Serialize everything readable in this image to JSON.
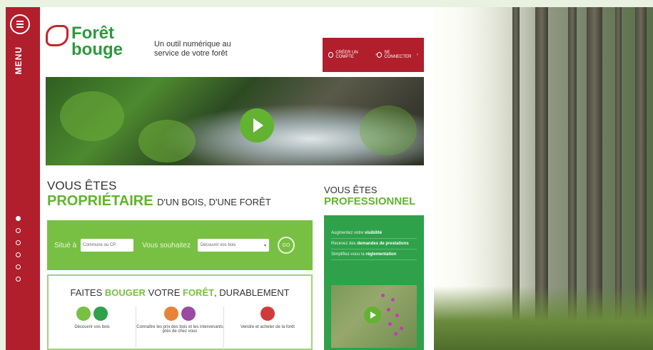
{
  "sidebar": {
    "menu_label": "MENU",
    "dots": 6,
    "active_dot": 0
  },
  "header": {
    "logo_text_top": "Forêt",
    "logo_text_bottom": "bouge",
    "tagline": "Un outil numérique au service de votre forêt",
    "create_account": "CRÉER UN COMPTE",
    "login": "SE CONNECTER"
  },
  "owner": {
    "line1": "VOUS ÊTES",
    "highlight": "PROPRIÉTAIRE",
    "rest": "D'UN BOIS, D'UNE FORÊT",
    "search": {
      "situe_label": "Situé à",
      "commune_placeholder": "Commune ou CP",
      "souhaitez_label": "Vous souhaitez",
      "select_value": "Découvrir vos bois",
      "go_label": "GO"
    },
    "cards_title_pre": "FAITES",
    "cards_title_highlight1": "BOUGER",
    "cards_title_mid": "VOTRE",
    "cards_title_highlight2": "FORÊT",
    "cards_title_post": ", DURABLEMENT",
    "cards": [
      {
        "text": "Découvrir vos bois"
      },
      {
        "text": "Connaître les prix des bois et les intervenants près de chez vous"
      },
      {
        "text": "Vendre et acheter de la forêt"
      }
    ]
  },
  "pro": {
    "line1": "VOUS ÊTES",
    "highlight": "PROFESSIONNEL",
    "items": [
      {
        "pre": "Augmentez votre",
        "bold": "visibilité"
      },
      {
        "pre": "Recevez des",
        "bold": "demandes de prestations"
      },
      {
        "pre": "Simplifiez-vous la",
        "bold": "réglementation"
      }
    ]
  },
  "colors": {
    "brand_red": "#b01f2b",
    "brand_green": "#62b331",
    "pro_green": "#2fa14a"
  }
}
